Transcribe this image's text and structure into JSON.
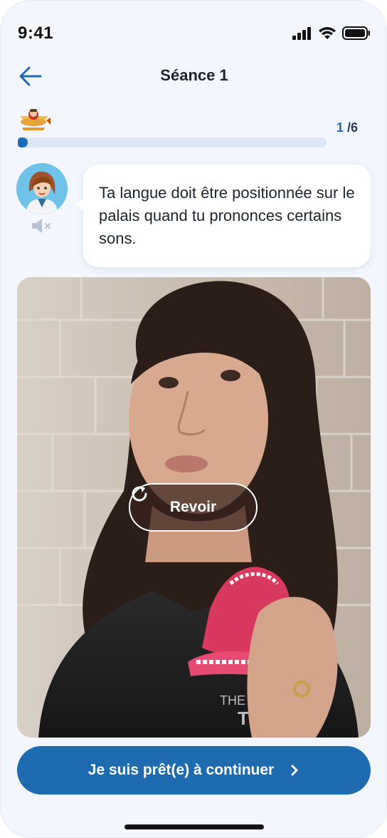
{
  "status_bar": {
    "time": "9:41"
  },
  "header": {
    "title": "Séance 1"
  },
  "progress": {
    "current": "1",
    "separator": "/",
    "total": "6",
    "fraction": 0.02
  },
  "message": {
    "text": "Ta langue doit être positionnée sur le palais quand tu prononces certains sons."
  },
  "video": {
    "replay_label": "Revoir"
  },
  "cta": {
    "label": "Je suis prêt(e) à continuer"
  },
  "colors": {
    "accent": "#1e6bb0",
    "background": "#f3f6fd",
    "track": "#dde6f7"
  },
  "icons": [
    "back-arrow-icon",
    "signal-icon",
    "wifi-icon",
    "battery-icon",
    "airplane-mascot-icon",
    "speaker-muted-icon",
    "replay-icon",
    "chevron-right-icon"
  ]
}
